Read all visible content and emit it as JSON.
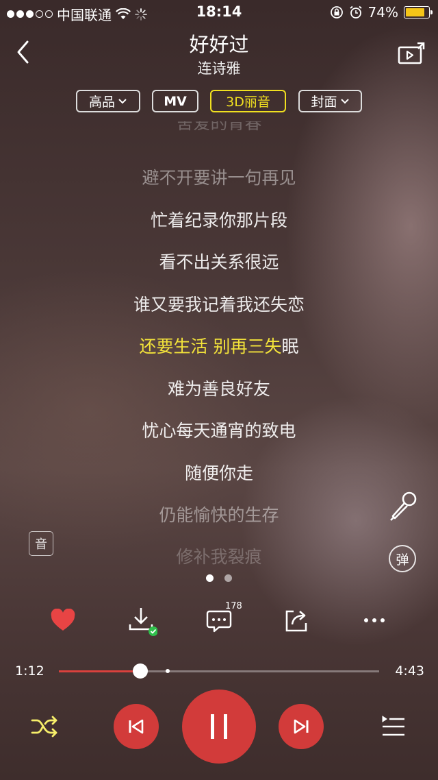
{
  "status_bar": {
    "carrier": "中国联通",
    "time": "18:14",
    "battery": "74%",
    "battery_color": "#f5c518"
  },
  "header": {
    "title": "好好过",
    "artist": "连诗雅",
    "back_icon": "chevron-left-icon",
    "cast_icon": "screen-cast-icon"
  },
  "options": {
    "quality": "高品",
    "mv": "MV",
    "sound": "3D丽音",
    "cover": "封面"
  },
  "lyrics": {
    "l0": "舍爱的青春",
    "l1": "避不开要讲一句再见",
    "l2": "忙着纪录你那片段",
    "l3": "看不出关系很远",
    "l4": "谁又要我记着我还失恋",
    "l5_sung": "还要生活 别再三失",
    "l5_rest": "眠",
    "l6": "难为善良好友",
    "l7": "忧心每天通宵的致电",
    "l8": "随便你走",
    "l9": "仍能愉快的生存",
    "l10": "修补我裂痕",
    "highlight_color": "#f3e33a"
  },
  "side": {
    "sound_label": "音",
    "danmaku_label": "弹",
    "karaoke_icon": "microphone-icon"
  },
  "pager": {
    "pages": 2,
    "current": 1
  },
  "actions": {
    "like_icon": "heart-icon",
    "download_icon": "download-icon",
    "comment_icon": "comment-icon",
    "comment_count": "178",
    "share_icon": "share-icon",
    "more_icon": "more-icon"
  },
  "progress": {
    "elapsed": "1:12",
    "total": "4:43",
    "fraction": 0.254,
    "buffered_fraction": 0.34,
    "accent": "#d9413d"
  },
  "controls": {
    "shuffle_icon": "shuffle-icon",
    "prev_icon": "previous-icon",
    "pause_icon": "pause-icon",
    "next_icon": "next-icon",
    "playlist_icon": "playlist-icon",
    "button_color": "#d23b3a"
  }
}
